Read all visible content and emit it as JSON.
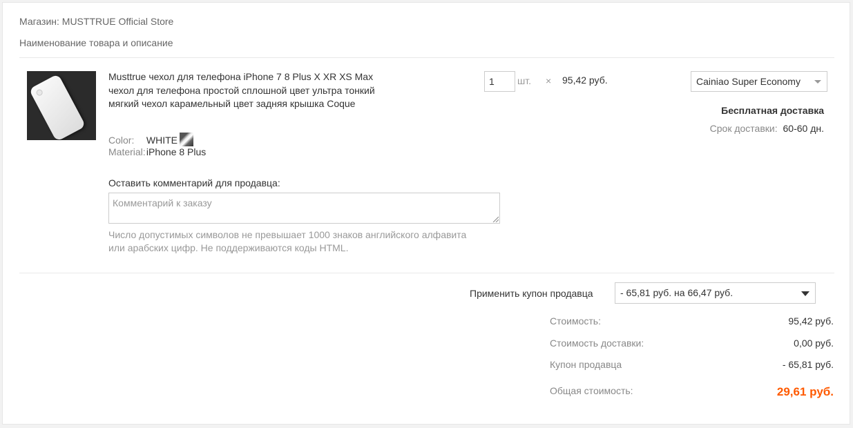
{
  "store": {
    "label": "Магазин: MUSTTRUE Official Store"
  },
  "header": {
    "product_column": "Наименование товара и описание"
  },
  "product": {
    "title": "Musttrue чехол для телефона iPhone 7 8 Plus X XR XS Max чехол для телефона простой сплошной цвет ультра тонкий мягкий чехол карамельный цвет задняя крышка Coque",
    "attributes": [
      {
        "key": "Color:",
        "value": "WHITE"
      },
      {
        "key": "Material:",
        "value": "iPhone 8 Plus"
      }
    ],
    "quantity": "1",
    "quantity_unit": "шт.",
    "times_sign": "×",
    "unit_price": "95,42 руб."
  },
  "comment": {
    "label": "Оставить комментарий для продавца:",
    "placeholder": "Комментарий к заказу",
    "hint": "Число допустимых символов не превышает 1000 знаков английского алфавита или арабских цифр. Не поддерживаются коды HTML."
  },
  "shipping": {
    "method": "Cainiao Super Economy",
    "free_label": "Бесплатная доставка",
    "eta_label": "Срок доставки:",
    "eta_value": "60-60 дн."
  },
  "coupon": {
    "label": "Применить купон продавца",
    "selected": "- 65,81 руб. на 66,47 руб."
  },
  "summary": {
    "rows": [
      {
        "label": "Стоимость:",
        "value": "95,42 руб."
      },
      {
        "label": "Стоимость доставки:",
        "value": "0,00 руб."
      },
      {
        "label": "Купон продавца",
        "value": "- 65,81 руб."
      }
    ],
    "total_label": "Общая стоимость:",
    "total_value": "29,61 руб."
  },
  "colors": {
    "accent_total": "#ff5a00",
    "border": "#cccccc",
    "muted_text": "#888888"
  },
  "icons": {
    "dropdown": "chevron-down-icon",
    "resize": "resize-grip-icon"
  }
}
